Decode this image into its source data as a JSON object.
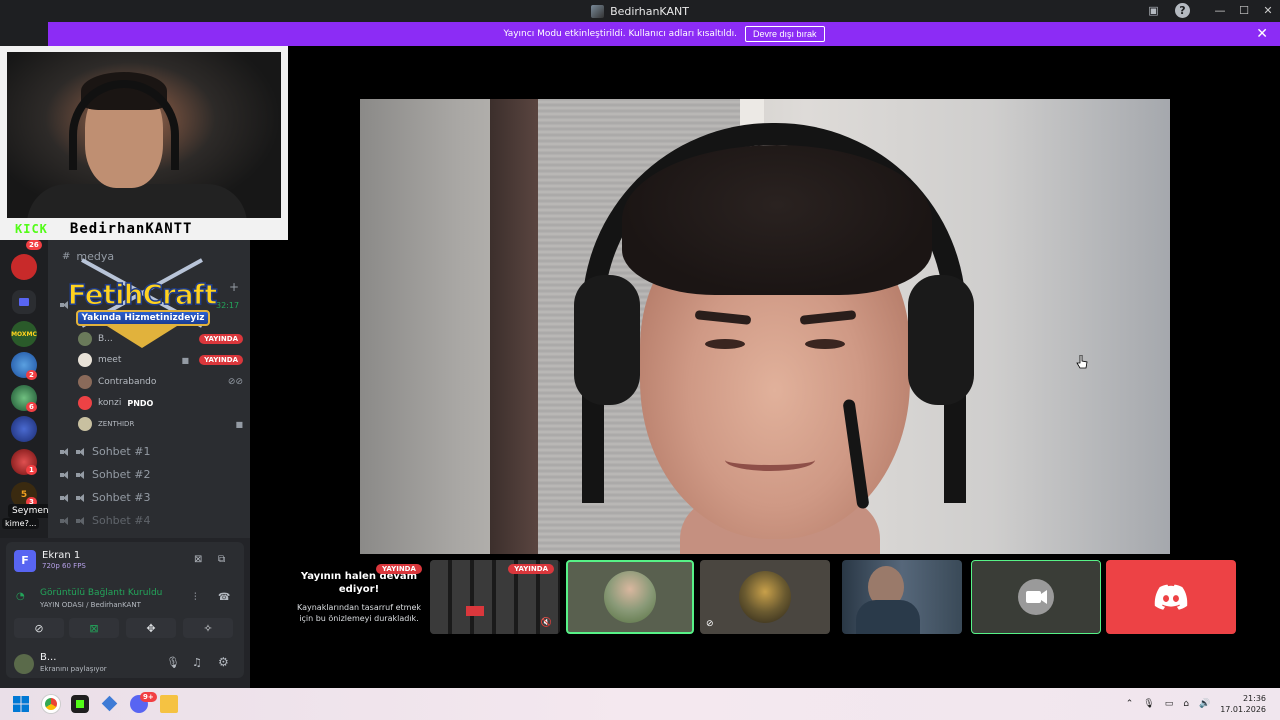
{
  "window": {
    "title": "BedirhanKANT",
    "controls": [
      "—",
      "☐",
      "✕"
    ]
  },
  "banner": {
    "text": "Yayıncı Modu etkinleştirildi. Kullanıcı adları kısaltıldı.",
    "button": "Devre dışı bırak",
    "close": "✕"
  },
  "servers": [
    {
      "badge": "26"
    },
    {
      "badge": ""
    },
    {
      "badge": ""
    },
    {
      "badge": ""
    },
    {
      "badge": "2"
    },
    {
      "badge": "6"
    },
    {
      "badge": ""
    },
    {
      "badge": "1"
    },
    {
      "badge": "3"
    }
  ],
  "server_label": "MOXMC",
  "tooltip": {
    "name": "Seymenler",
    "sub": "kime?..."
  },
  "webcam_overlay": {
    "brand": "KICK",
    "name": "BedirhanKANTT"
  },
  "promo": {
    "title": "FetihCraft",
    "subtitle": "Yakında Hizmetinizdeyiz"
  },
  "channels": {
    "text_channel": "medya",
    "time": "32:17",
    "members": [
      {
        "name": "B...",
        "live": "YAYINDA",
        "color": "#6a7a5a"
      },
      {
        "name": "meet",
        "live": "YAYINDA",
        "color": "#e8e2d8"
      },
      {
        "name": "Contrabando",
        "live": "",
        "color": "#8a6a5a"
      },
      {
        "name": "konzi",
        "status": "PNDO",
        "live": "",
        "color": "#ed4245"
      },
      {
        "name": "ZENTHIDR",
        "live": "",
        "color": "#c8c0a0"
      }
    ],
    "voice_channels": [
      "Sohbet #1",
      "Sohbet #2",
      "Sohbet #3",
      "Sohbet #4"
    ]
  },
  "user_panel": {
    "screen_title": "Ekran 1",
    "screen_quality": "720p 60 FPS",
    "voice_status": "Görüntülü Bağlantı Kuruldu",
    "voice_channel": "YAYIN ODASI / BedirhanKANT",
    "username": "B...",
    "user_status": "Ekranını paylaşıyor"
  },
  "stream_tiles": {
    "paused_title": "Yayının halen devam ediyor!",
    "paused_sub": "Kaynaklarından tasarruf etmek için bu önizlemeyi durakladık.",
    "live_label": "YAYINDA",
    "live_label2": "YAYINDA"
  },
  "taskbar": {
    "time": "21:36",
    "date": "17.01.2026",
    "chat_badge": "9+"
  },
  "colors": {
    "banner": "#8c2cf5",
    "live": "#da373c",
    "discord": "#ed4245",
    "connected": "#23a55a"
  }
}
